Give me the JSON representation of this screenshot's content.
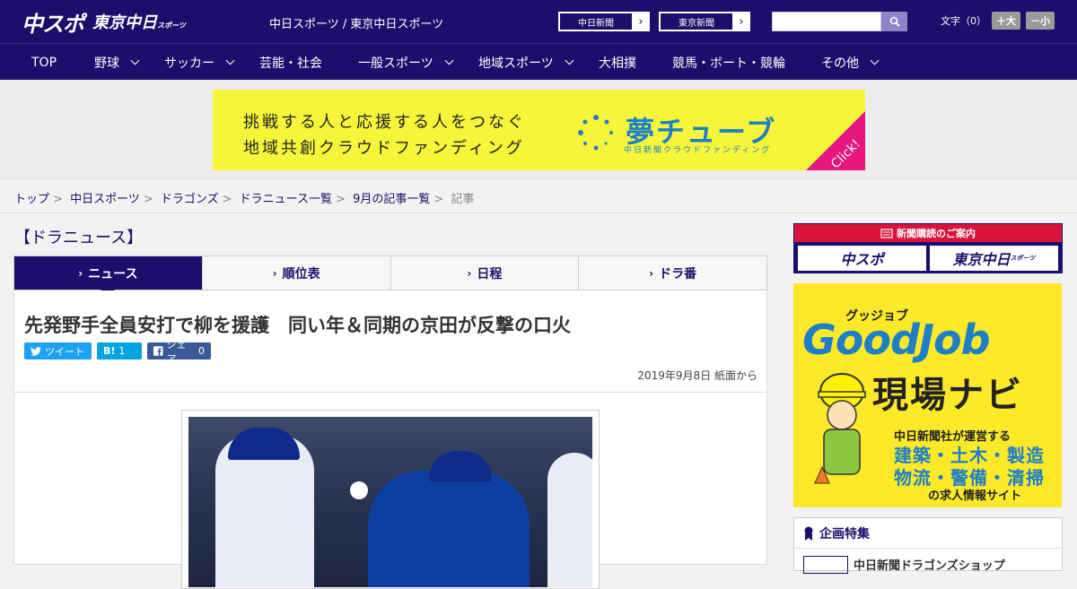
{
  "header": {
    "logo_primary": "中スポ",
    "logo_secondary": "東京中日",
    "logo_secondary_small": "スポーツ",
    "site_name": "中日スポーツ / 東京中日スポーツ",
    "paper_links": [
      {
        "label": "中日新聞"
      },
      {
        "label": "東京新聞"
      }
    ],
    "search": {
      "placeholder": "",
      "value": ""
    },
    "font_size_label": "文字（0）",
    "font_larger": "＋大",
    "font_smaller": "－小"
  },
  "nav": {
    "items": [
      {
        "label": "TOP",
        "dropdown": false
      },
      {
        "label": "野球",
        "dropdown": true
      },
      {
        "label": "サッカー",
        "dropdown": true
      },
      {
        "label": "芸能・社会",
        "dropdown": false
      },
      {
        "label": "一般スポーツ",
        "dropdown": true
      },
      {
        "label": "地域スポーツ",
        "dropdown": true
      },
      {
        "label": "大相撲",
        "dropdown": false
      },
      {
        "label": "競馬・ボート・競輪",
        "dropdown": false
      },
      {
        "label": "その他",
        "dropdown": true
      }
    ]
  },
  "banner": {
    "line1": "挑戦する人と応援する人をつなぐ",
    "line2": "地域共創クラウドファンディング",
    "brand": "夢チューブ",
    "brand_sub": "中日新聞クラウドファンディング",
    "click": "Click!",
    "bg_color": "#f5f53a",
    "accent_color": "#e6167e"
  },
  "breadcrumb": {
    "items": [
      "トップ",
      "中日スポーツ",
      "ドラゴンズ",
      "ドラニュース一覧",
      "9月の記事一覧"
    ],
    "current": "記事"
  },
  "section": {
    "title": "【ドラニュース】",
    "tabs": [
      {
        "label": "ニュース",
        "active": true
      },
      {
        "label": "順位表",
        "active": false
      },
      {
        "label": "日程",
        "active": false
      },
      {
        "label": "ドラ番",
        "active": false
      }
    ]
  },
  "article": {
    "headline": "先発野手全員安打で柳を援護　同い年＆同期の京田が反撃の口火",
    "share": {
      "tweet": "ツイート",
      "hatena_label": "B!",
      "hatena_count": "1",
      "facebook": "シェア",
      "facebook_count": "0"
    },
    "date": "2019年9月8日 紙面から"
  },
  "sidebar": {
    "subscribe_header": "新聞購読のご案内",
    "subscribe_buttons": [
      "中スポ",
      "東京中日"
    ],
    "subscribe_button_small": "スポーツ",
    "goodjob": {
      "kana": "グッジョブ",
      "title": "GoodJob",
      "navi": "現場ナビ",
      "line1": "中日新聞社が運営する",
      "line2": "建築・土木・製造",
      "line3": "物流・警備・清掃",
      "line4": "の求人情報サイト"
    },
    "feature": {
      "title": "企画特集",
      "item": "中日新聞ドラゴンズショップ"
    }
  },
  "colors": {
    "brand_navy": "#1b0f6b",
    "accent_red": "#d9143c",
    "twitter": "#1da1f2",
    "hatena": "#00a4de",
    "facebook": "#3b5998"
  }
}
